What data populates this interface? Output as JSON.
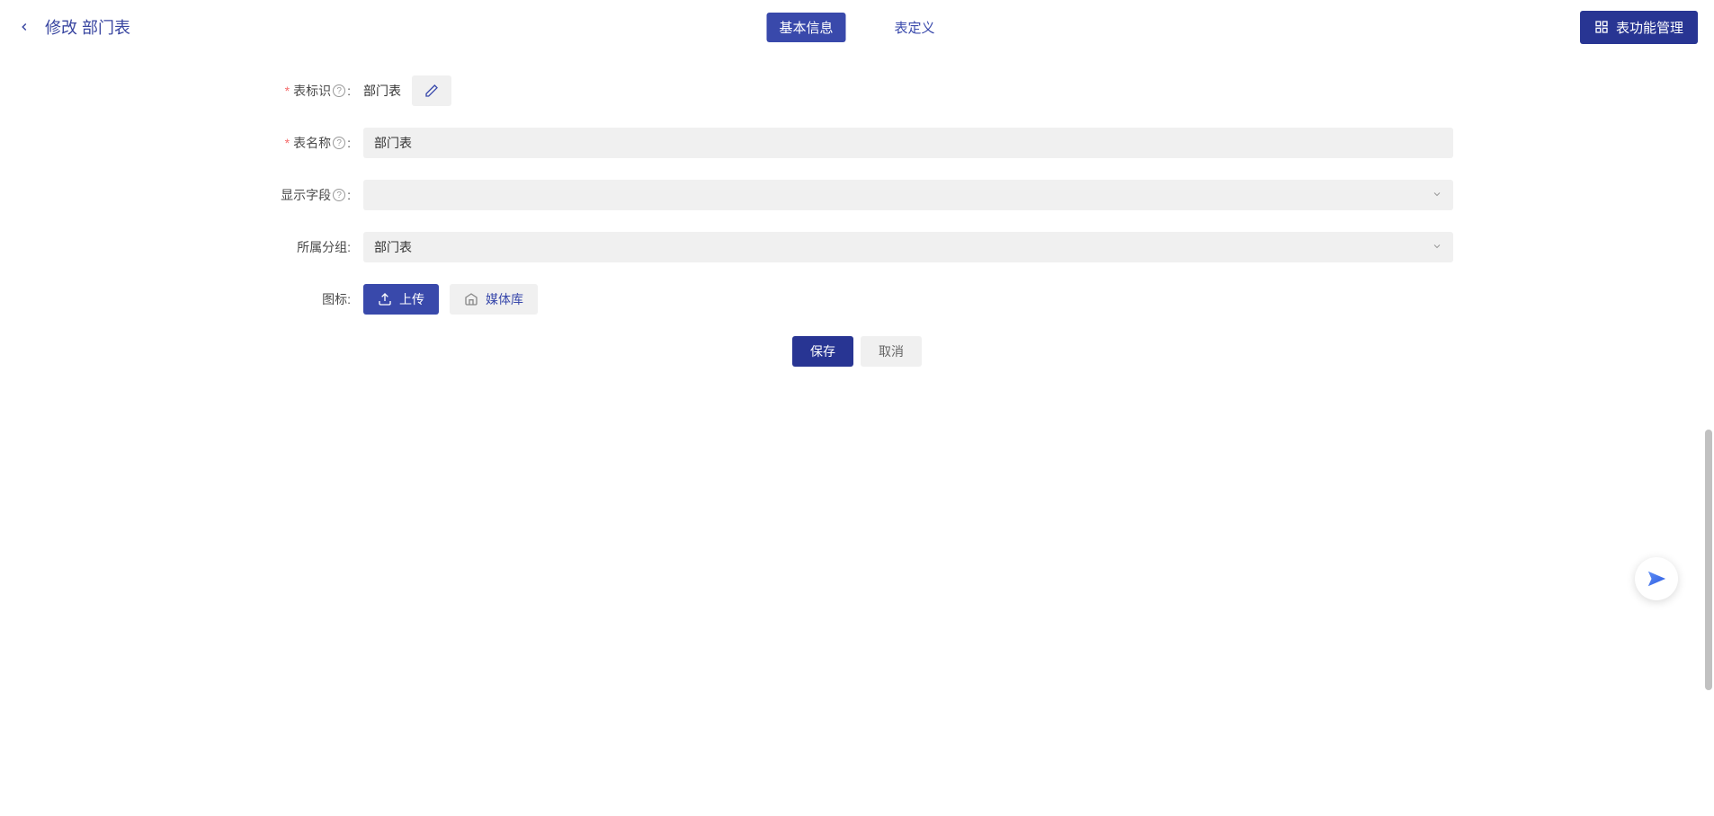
{
  "header": {
    "title": "修改 部门表",
    "tabs": {
      "basic": "基本信息",
      "def": "表定义"
    },
    "right_button": "表功能管理"
  },
  "form": {
    "identifier": {
      "label": "表标识",
      "value": "部门表"
    },
    "name": {
      "label": "表名称",
      "value": "部门表"
    },
    "display_field": {
      "label": "显示字段",
      "value": ""
    },
    "group": {
      "label": "所属分组",
      "value": "部门表"
    },
    "icon": {
      "label": "图标",
      "upload": "上传",
      "media": "媒体库"
    }
  },
  "actions": {
    "save": "保存",
    "cancel": "取消"
  },
  "punct": {
    "colon": ":"
  }
}
